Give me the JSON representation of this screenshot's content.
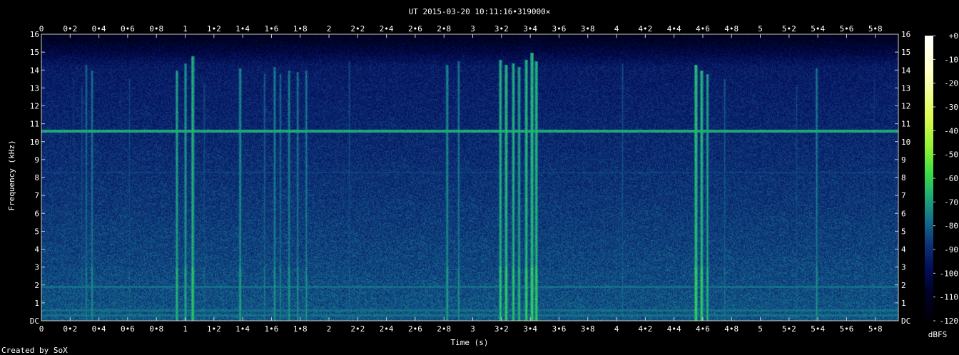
{
  "chart_data": {
    "type": "heatmap",
    "title": "UT 2015-03-20 10:11:16•319000×",
    "xlabel": "Time (s)",
    "ylabel": "Frequency (kHz)",
    "xlim": [
      0,
      5.96
    ],
    "ylim": [
      0,
      16
    ],
    "x_ticks": [
      "0",
      "0•2",
      "0•4",
      "0•6",
      "0•8",
      "1",
      "1•2",
      "1•4",
      "1•6",
      "1•8",
      "2",
      "2•2",
      "2•4",
      "2•6",
      "2•8",
      "3",
      "3•2",
      "3•4",
      "3•6",
      "3•8",
      "4",
      "4•2",
      "4•4",
      "4•6",
      "4•8",
      "5",
      "5•2",
      "5•4",
      "5•6",
      "5•8"
    ],
    "x_tick_values": [
      0,
      0.2,
      0.4,
      0.6,
      0.8,
      1,
      1.2,
      1.4,
      1.6,
      1.8,
      2,
      2.2,
      2.4,
      2.6,
      2.8,
      3,
      3.2,
      3.4,
      3.6,
      3.8,
      4,
      4.2,
      4.4,
      4.6,
      4.8,
      5,
      5.2,
      5.4,
      5.6,
      5.8
    ],
    "y_ticks": [
      "DC",
      "1",
      "2",
      "3",
      "4",
      "5",
      "6",
      "7",
      "8",
      "9",
      "10",
      "11",
      "12",
      "13",
      "14",
      "15",
      "16"
    ],
    "y_tick_values": [
      0,
      1,
      2,
      3,
      4,
      5,
      6,
      7,
      8,
      9,
      10,
      11,
      12,
      13,
      14,
      15,
      16
    ],
    "colorbar": {
      "label": "dBFS",
      "ticks": [
        "+0",
        "-10",
        "-20",
        "-30",
        "-40",
        "-50",
        "-60",
        "-70",
        "-80",
        "-90",
        "-100",
        "-110",
        "-120"
      ],
      "tick_values": [
        0,
        -10,
        -20,
        -30,
        -40,
        -50,
        -60,
        -70,
        -80,
        -90,
        -100,
        -110,
        -120
      ],
      "range": [
        -120,
        0
      ]
    },
    "features": {
      "tone_khz": 10.6,
      "tone_dbfs": -68,
      "weak_tone_khz": 8.3,
      "low_hum_khz": [
        0.3,
        0.6,
        1.9
      ],
      "clicks": [
        {
          "t": 0.22,
          "top": 13.6,
          "level": -82
        },
        {
          "t": 0.28,
          "top": 13.2,
          "level": -78
        },
        {
          "t": 0.31,
          "top": 14.3,
          "level": -72
        },
        {
          "t": 0.35,
          "top": 14.0,
          "level": -70
        },
        {
          "t": 0.55,
          "top": 13.0,
          "level": -84
        },
        {
          "t": 0.61,
          "top": 13.5,
          "level": -80
        },
        {
          "t": 0.94,
          "top": 14.0,
          "level": -62
        },
        {
          "t": 1.0,
          "top": 14.4,
          "level": -64
        },
        {
          "t": 1.05,
          "top": 14.8,
          "level": -58
        },
        {
          "t": 1.13,
          "top": 13.3,
          "level": -78
        },
        {
          "t": 1.38,
          "top": 14.1,
          "level": -66
        },
        {
          "t": 1.55,
          "top": 13.8,
          "level": -74
        },
        {
          "t": 1.62,
          "top": 14.2,
          "level": -68
        },
        {
          "t": 1.66,
          "top": 13.8,
          "level": -72
        },
        {
          "t": 1.72,
          "top": 14.0,
          "level": -68
        },
        {
          "t": 1.78,
          "top": 13.9,
          "level": -70
        },
        {
          "t": 1.84,
          "top": 14.0,
          "level": -70
        },
        {
          "t": 2.14,
          "top": 14.5,
          "level": -78
        },
        {
          "t": 2.82,
          "top": 14.3,
          "level": -66
        },
        {
          "t": 2.9,
          "top": 14.5,
          "level": -70
        },
        {
          "t": 3.19,
          "top": 14.6,
          "level": -60
        },
        {
          "t": 3.23,
          "top": 14.3,
          "level": -58
        },
        {
          "t": 3.28,
          "top": 14.4,
          "level": -60
        },
        {
          "t": 3.32,
          "top": 14.2,
          "level": -62
        },
        {
          "t": 3.37,
          "top": 14.6,
          "level": -58
        },
        {
          "t": 3.41,
          "top": 15.0,
          "level": -56
        },
        {
          "t": 3.44,
          "top": 14.5,
          "level": -58
        },
        {
          "t": 4.04,
          "top": 14.4,
          "level": -78
        },
        {
          "t": 4.55,
          "top": 14.3,
          "level": -56
        },
        {
          "t": 4.59,
          "top": 14.0,
          "level": -58
        },
        {
          "t": 4.63,
          "top": 13.8,
          "level": -64
        },
        {
          "t": 4.75,
          "top": 13.5,
          "level": -76
        },
        {
          "t": 5.25,
          "top": 13.2,
          "level": -80
        },
        {
          "t": 5.39,
          "top": 14.1,
          "level": -70
        },
        {
          "t": 5.79,
          "top": 13.5,
          "level": -82
        }
      ]
    }
  },
  "credit": "Created by SoX"
}
